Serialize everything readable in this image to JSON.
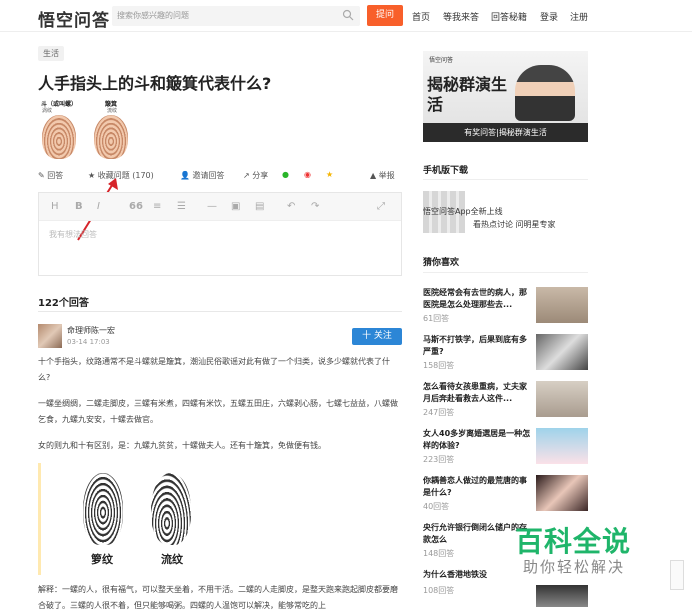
{
  "header": {
    "logo": "悟空问答",
    "search_placeholder": "搜索你感兴趣的问题",
    "ask": "提问",
    "nav": [
      "首页",
      "等我来答",
      "回答秘籍",
      "登录",
      "注册"
    ]
  },
  "question": {
    "tag": "生活",
    "title": "人手指头上的斗和簸箕代表什么?",
    "fp_labels": [
      "斗（或叫螺）",
      "簸箕"
    ],
    "fp_sub": [
      "涡纹",
      "流纹"
    ]
  },
  "actions": {
    "answer": "回答",
    "collect": "收藏问题 (170)",
    "invite": "邀请回答",
    "share": "分享",
    "report": "举报"
  },
  "editor": {
    "placeholder": "我有想法回答"
  },
  "answers": {
    "count_label": "122个回答",
    "author": "命理师陈一宏",
    "date": "03-14 17:03",
    "follow": "十 关注",
    "p1": "十个手指头，纹路通常不是斗螺就是簸箕，潮汕民俗歌谣对此有做了一个归类，说多少螺就代表了什么?",
    "p2": "一螺坐绸绸，二螺走脚皮，三螺有米煮，四螺有米饮，五螺五田庄，六螺剥心肠，七螺七益益，八螺做乞食，九螺九安安，十螺去做官。",
    "p3": "女的则九和十有区别，是：九螺九贫贫，十螺做夫人。还有十簸箕，免做便有钱。",
    "img_labels": [
      "箩纹",
      "流纹"
    ],
    "p4": "解释：一螺的人，很有福气，可以整天坐着，不用干活。二螺的人走脚皮，是整天跑来跑起脚皮都要磨合破了。三螺的人很不着，但只能够喝粥。四螺的人温饱可以解决，能够常吃的上"
  },
  "sidebar": {
    "banner_title": "揭秘群演生活",
    "banner_caption": "有奖问答|揭秘群演生活",
    "banner_brand": "悟空问答",
    "download_head": "手机版下载",
    "app_line1": "悟空问答App全新上线",
    "app_line2": "看热点讨论 问明星专家",
    "guess_head": "猜你喜欢",
    "items": [
      {
        "title": "医院经常会有去世的病人，那医院是怎么处理那些去...",
        "count": "61回答"
      },
      {
        "title": "马斯不打铁学，后果到底有多严重?",
        "count": "158回答"
      },
      {
        "title": "怎么看待女孩患重病，丈夫家月后奔赴看救去人这件...",
        "count": "247回答"
      },
      {
        "title": "女人40多岁离婚選居是一种怎样的体验?",
        "count": "223回答"
      },
      {
        "title": "你耦善恋人做过的最荒唐的事是什么?",
        "count": "40回答"
      },
      {
        "title": "央行允许银行倒闭么储户的存款怎么",
        "count": "148回答"
      },
      {
        "title": "为什么香港地铁没",
        "count": "108回答"
      }
    ]
  },
  "watermark": {
    "line1": "百科全说",
    "line2": "助你轻松解决"
  },
  "colors": {
    "accent": "#f85f2a",
    "follow": "#2c86d6",
    "watermark": "#1fb56a"
  }
}
